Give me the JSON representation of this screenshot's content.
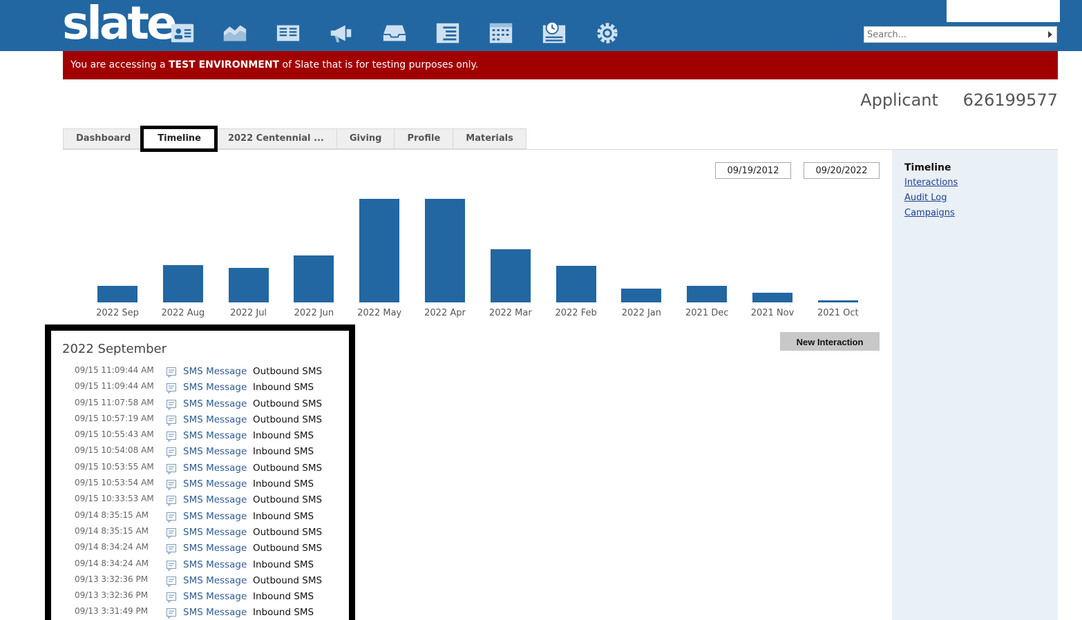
{
  "app": {
    "logo_text": "slate",
    "nav_icons": [
      "records-icon",
      "analytics-icon",
      "forms-icon",
      "campaigns-icon",
      "inbox-icon",
      "queries-icon",
      "calendar-icon",
      "timeline-icon",
      "settings-icon"
    ],
    "search": {
      "placeholder": "Search..."
    },
    "brand_color": "#2267a2"
  },
  "banner": {
    "prefix": "You are accessing a ",
    "strong": "TEST ENVIRONMENT",
    "suffix": " of Slate that is for testing purposes only.",
    "color": "#a10000"
  },
  "record": {
    "type": "Applicant",
    "id": "626199577"
  },
  "tabs": [
    {
      "label": "Dashboard"
    },
    {
      "label": "Timeline",
      "active": true
    },
    {
      "label": "2022 Centennial ..."
    },
    {
      "label": "Giving"
    },
    {
      "label": "Profile"
    },
    {
      "label": "Materials"
    }
  ],
  "date_range": {
    "start": "09/19/2012",
    "end": "09/20/2022"
  },
  "sidebar": {
    "title": "Timeline",
    "links": [
      "Interactions",
      "Audit Log",
      "Campaigns"
    ]
  },
  "chart_data": {
    "type": "bar",
    "categories": [
      "2022 Sep",
      "2022 Aug",
      "2022 Jul",
      "2022 Jun",
      "2022 May",
      "2022 Apr",
      "2022 Mar",
      "2022 Feb",
      "2022 Jan",
      "2021 Dec",
      "2021 Nov",
      "2021 Oct"
    ],
    "values": [
      16,
      36,
      33,
      45,
      100,
      100,
      51,
      35,
      13,
      16,
      9,
      2
    ],
    "value_scale": "relative (tallest bar = 100)",
    "color": "#2267a2"
  },
  "actions": {
    "new_interaction": "New Interaction"
  },
  "timeline": {
    "month": "2022 September",
    "entries": [
      {
        "time": "09/15 11:09:44 AM",
        "type": "SMS Message",
        "desc": "Outbound SMS"
      },
      {
        "time": "09/15 11:09:44 AM",
        "type": "SMS Message",
        "desc": "Inbound SMS"
      },
      {
        "time": "09/15 11:07:58 AM",
        "type": "SMS Message",
        "desc": "Outbound SMS"
      },
      {
        "time": "09/15 10:57:19 AM",
        "type": "SMS Message",
        "desc": "Outbound SMS"
      },
      {
        "time": "09/15 10:55:43 AM",
        "type": "SMS Message",
        "desc": "Inbound SMS"
      },
      {
        "time": "09/15 10:54:08 AM",
        "type": "SMS Message",
        "desc": "Inbound SMS"
      },
      {
        "time": "09/15 10:53:55 AM",
        "type": "SMS Message",
        "desc": "Outbound SMS"
      },
      {
        "time": "09/15 10:53:54 AM",
        "type": "SMS Message",
        "desc": "Inbound SMS"
      },
      {
        "time": "09/15 10:33:53 AM",
        "type": "SMS Message",
        "desc": "Outbound SMS"
      },
      {
        "time": "09/14 8:35:15 AM",
        "type": "SMS Message",
        "desc": "Inbound SMS"
      },
      {
        "time": "09/14 8:35:15 AM",
        "type": "SMS Message",
        "desc": "Outbound SMS"
      },
      {
        "time": "09/14 8:34:24 AM",
        "type": "SMS Message",
        "desc": "Outbound SMS"
      },
      {
        "time": "09/14 8:34:24 AM",
        "type": "SMS Message",
        "desc": "Inbound SMS"
      },
      {
        "time": "09/13 3:32:36 PM",
        "type": "SMS Message",
        "desc": "Outbound SMS"
      },
      {
        "time": "09/13 3:32:36 PM",
        "type": "SMS Message",
        "desc": "Inbound SMS"
      },
      {
        "time": "09/13 3:31:49 PM",
        "type": "SMS Message",
        "desc": "Inbound SMS"
      }
    ]
  }
}
